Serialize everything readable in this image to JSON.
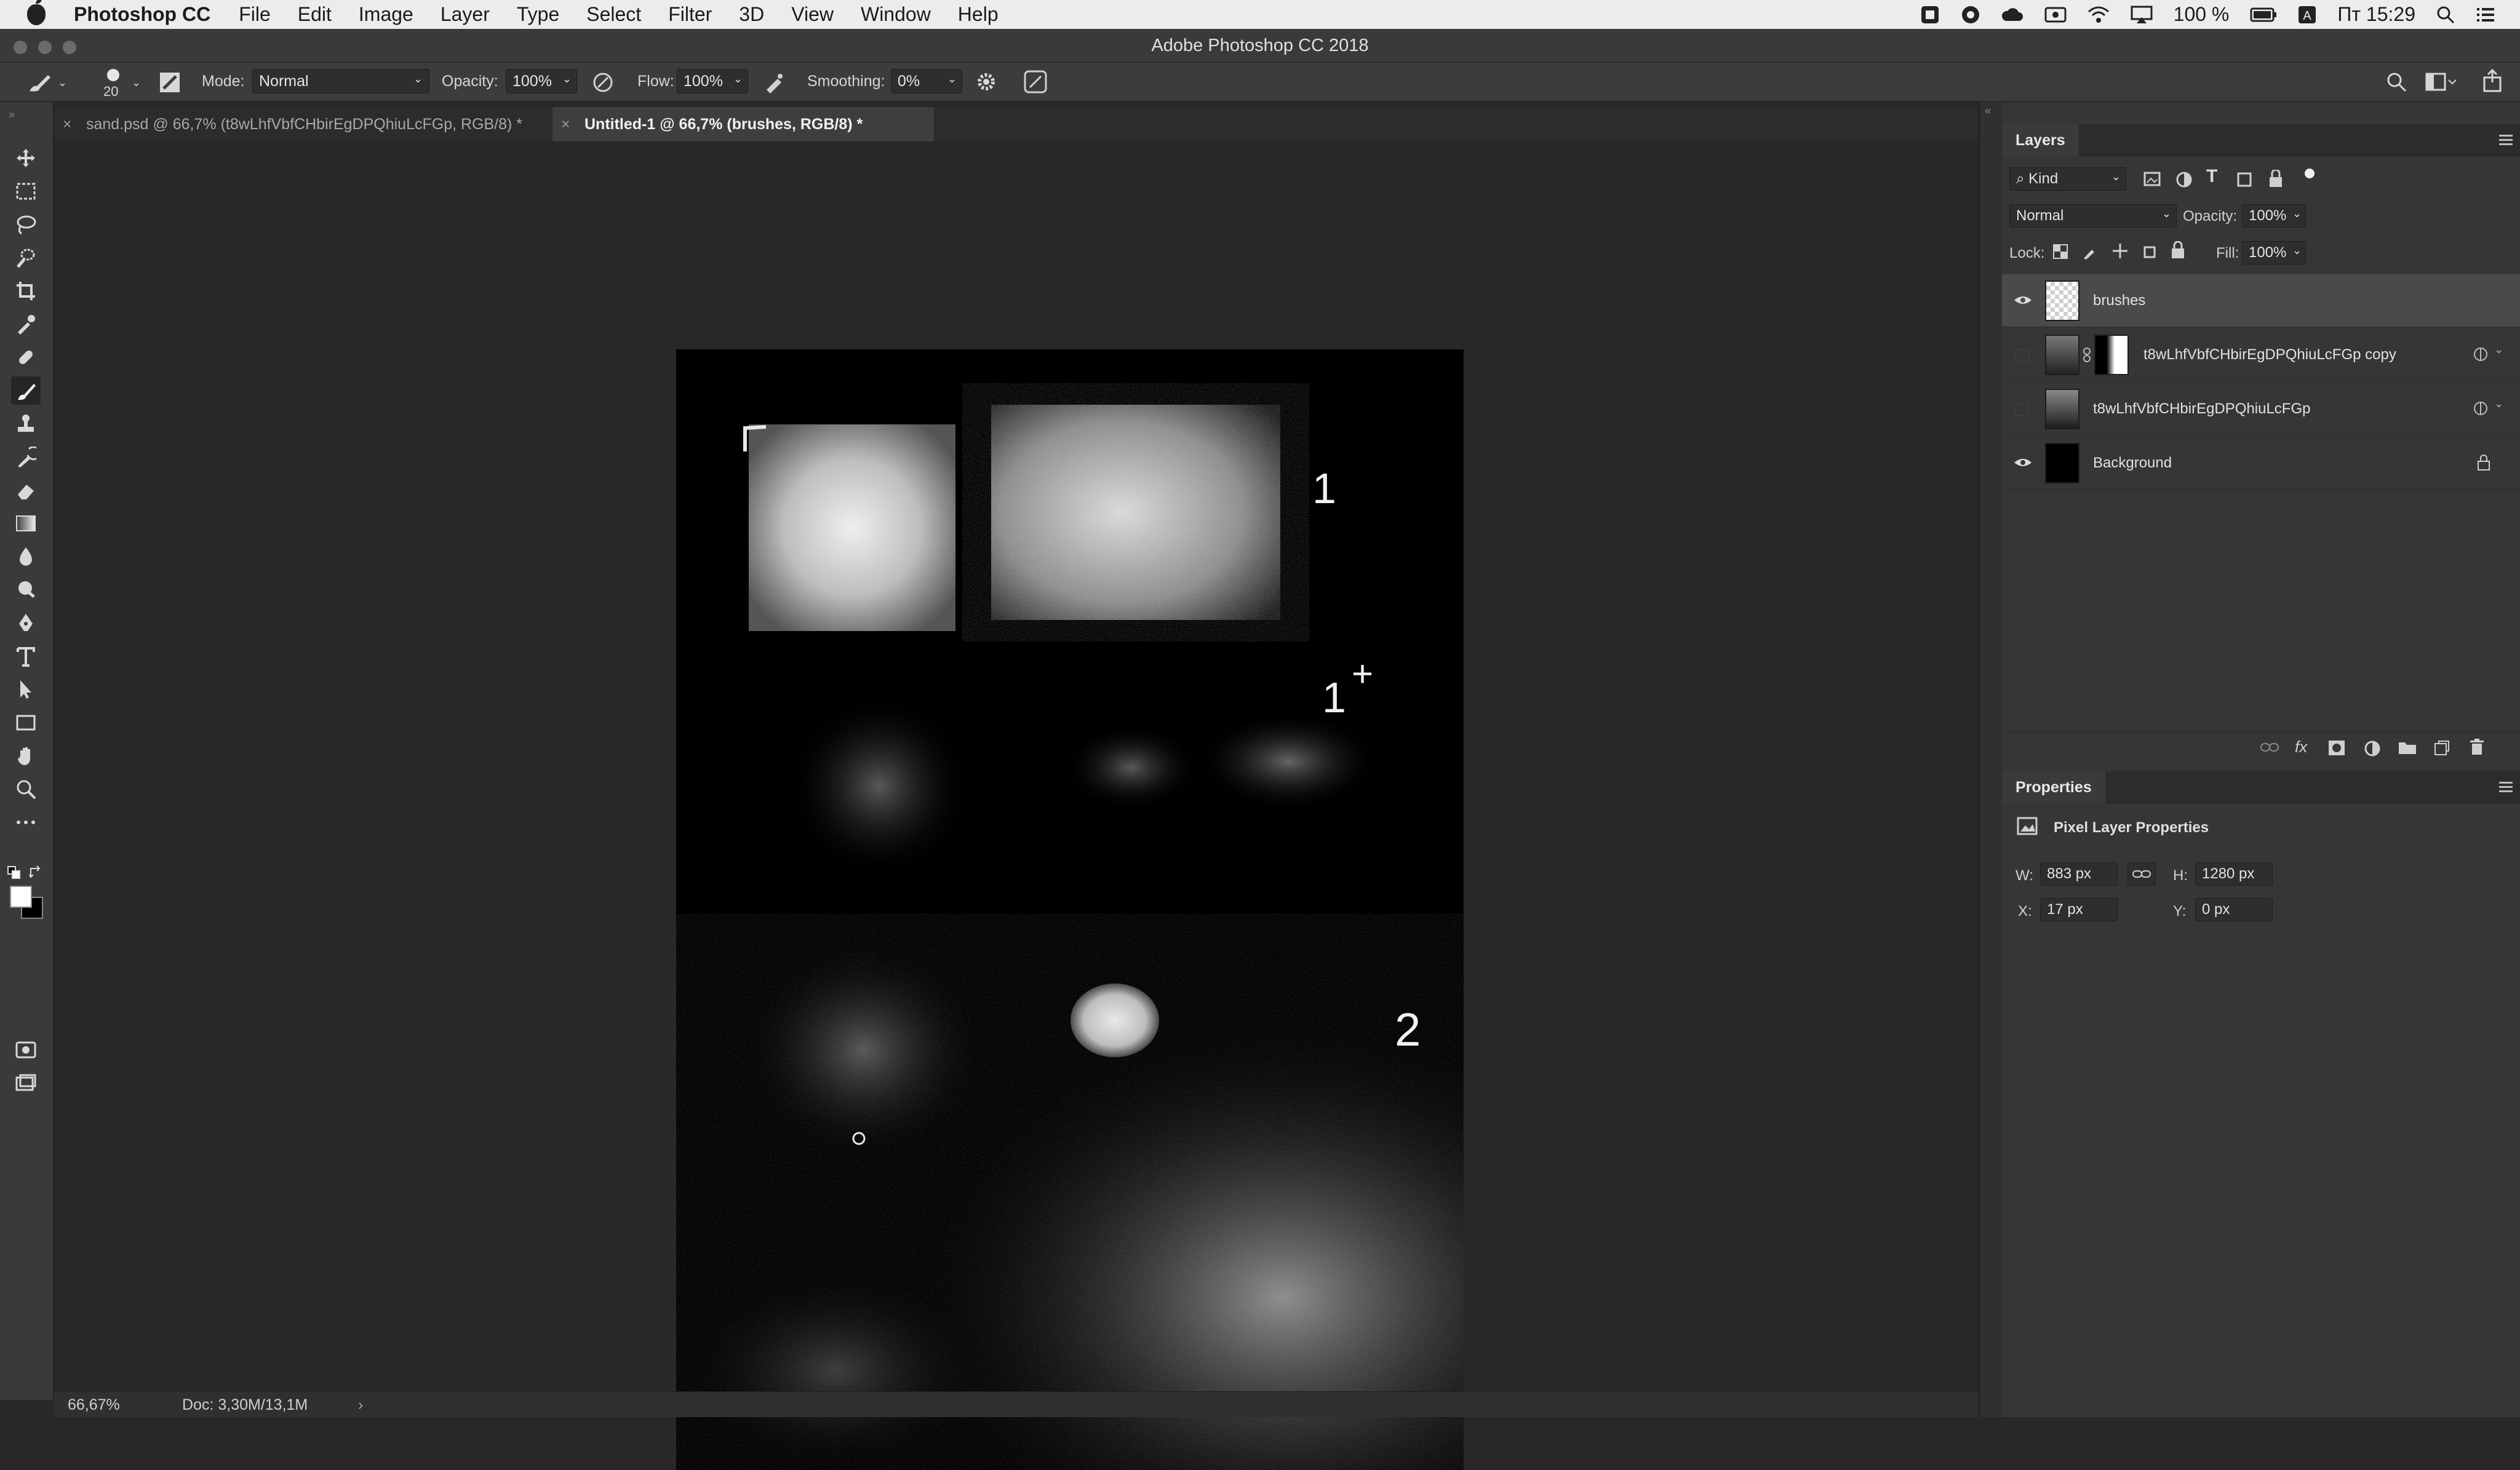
{
  "menubar": {
    "app_name": "Photoshop CC",
    "items": [
      "File",
      "Edit",
      "Image",
      "Layer",
      "Type",
      "Select",
      "Filter",
      "3D",
      "View",
      "Window",
      "Help"
    ],
    "battery": "100 %",
    "clock": "Пт 15:29"
  },
  "titlebar": {
    "title": "Adobe Photoshop CC 2018"
  },
  "options": {
    "brush_size": "20",
    "mode_label": "Mode:",
    "mode_value": "Normal",
    "opacity_label": "Opacity:",
    "opacity_value": "100%",
    "flow_label": "Flow:",
    "flow_value": "100%",
    "smoothing_label": "Smoothing:",
    "smoothing_value": "0%"
  },
  "tabs": [
    {
      "label": "sand.psd @ 66,7% (t8wLhfVbfCHbirEgDPQhiuLcFGp, RGB/8) *",
      "active": false
    },
    {
      "label": "Untitled-1 @ 66,7% (brushes, RGB/8) *",
      "active": true
    }
  ],
  "canvas": {
    "annotations": [
      "1",
      "1",
      "+",
      "2"
    ]
  },
  "status": {
    "zoom": "66,67%",
    "doc": "Doc: 3,30M/13,1M"
  },
  "layers_panel": {
    "title": "Layers",
    "filter_kind": "Kind",
    "blend_mode": "Normal",
    "opacity_label": "Opacity:",
    "opacity_value": "100%",
    "lock_label": "Lock:",
    "fill_label": "Fill:",
    "fill_value": "100%",
    "layers": [
      {
        "name": "brushes",
        "visible": true,
        "selected": true
      },
      {
        "name": "t8wLhfVbfCHbirEgDPQhiuLcFGp copy",
        "visible": false,
        "selected": false
      },
      {
        "name": "t8wLhfVbfCHbirEgDPQhiuLcFGp",
        "visible": false,
        "selected": false
      },
      {
        "name": "Background",
        "visible": true,
        "selected": false,
        "locked": true
      }
    ]
  },
  "properties_panel": {
    "title": "Properties",
    "subtitle": "Pixel Layer Properties",
    "w_label": "W:",
    "w_value": "883 px",
    "h_label": "H:",
    "h_value": "1280 px",
    "x_label": "X:",
    "x_value": "17 px",
    "y_label": "Y:",
    "y_value": "0 px"
  }
}
